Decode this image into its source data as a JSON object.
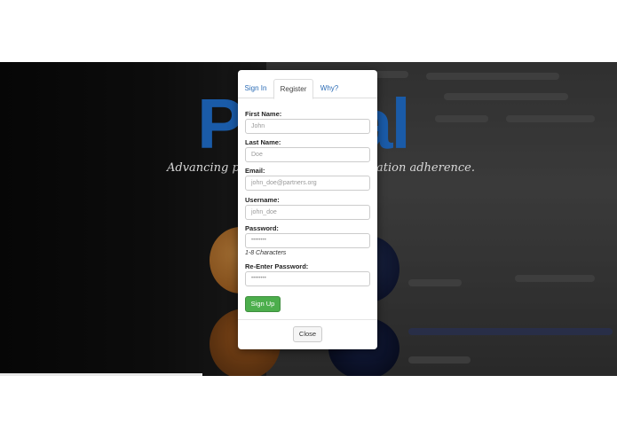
{
  "background": {
    "brand_text": "Pl",
    "brand_text_right": "al",
    "tagline_left": "Advancing pati",
    "tagline_right": "ation adherence."
  },
  "modal": {
    "tabs": [
      {
        "label": "Sign In"
      },
      {
        "label": "Register"
      },
      {
        "label": "Why?"
      }
    ],
    "fields": {
      "first_name": {
        "label": "First Name:",
        "placeholder": "John"
      },
      "last_name": {
        "label": "Last Name:",
        "placeholder": "Doe"
      },
      "email": {
        "label": "Email:",
        "placeholder": "john_doe@partners.org"
      },
      "username": {
        "label": "Username:",
        "placeholder": "john_doe"
      },
      "password": {
        "label": "Password:",
        "placeholder": "••••••••",
        "hint": "1-8 Characters"
      },
      "re_password": {
        "label": "Re-Enter Password:",
        "placeholder": "••••••••"
      }
    },
    "signup_label": "Sign Up",
    "close_label": "Close"
  },
  "colors": {
    "brand": "#1a5ba8",
    "success": "#4cae4c",
    "link": "#2a6bb5"
  }
}
